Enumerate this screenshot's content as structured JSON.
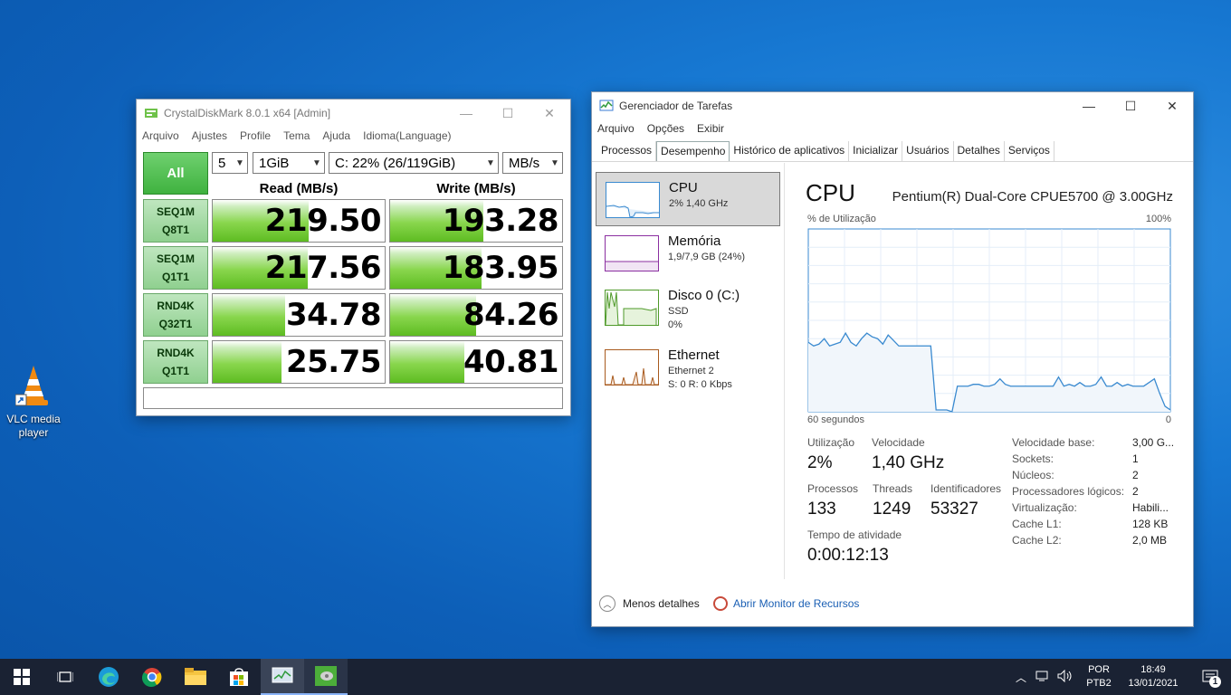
{
  "desktop": {
    "vlc_label": "VLC media player"
  },
  "cdm": {
    "title": "CrystalDiskMark 8.0.1 x64 [Admin]",
    "menu": [
      "Arquivo",
      "Ajustes",
      "Profile",
      "Tema",
      "Ajuda",
      "Idioma(Language)"
    ],
    "all_label": "All",
    "count": "5",
    "size": "1GiB",
    "drive": "C: 22% (26/119GiB)",
    "unit": "MB/s",
    "read_header": "Read (MB/s)",
    "write_header": "Write (MB/s)",
    "rows": [
      {
        "l1": "SEQ1M",
        "l2": "Q8T1",
        "read": "219.50",
        "write": "193.28",
        "read_frac": 0.56,
        "write_frac": 0.54
      },
      {
        "l1": "SEQ1M",
        "l2": "Q1T1",
        "read": "217.56",
        "write": "183.95",
        "read_frac": 0.55,
        "write_frac": 0.53
      },
      {
        "l1": "RND4K",
        "l2": "Q32T1",
        "read": "34.78",
        "write": "84.26",
        "read_frac": 0.42,
        "write_frac": 0.5
      },
      {
        "l1": "RND4K",
        "l2": "Q1T1",
        "read": "25.75",
        "write": "40.81",
        "read_frac": 0.4,
        "write_frac": 0.43
      }
    ]
  },
  "tm": {
    "title": "Gerenciador de Tarefas",
    "menu": [
      "Arquivo",
      "Opções",
      "Exibir"
    ],
    "tabs": [
      "Processos",
      "Desempenho",
      "Histórico de aplicativos",
      "Inicializar",
      "Usuários",
      "Detalhes",
      "Serviços"
    ],
    "side": [
      {
        "title": "CPU",
        "sub1": "2% 1,40 GHz",
        "sub2": "",
        "sub3": ""
      },
      {
        "title": "Memória",
        "sub1": "1,9/7,9 GB (24%)",
        "sub2": "",
        "sub3": ""
      },
      {
        "title": "Disco 0 (C:)",
        "sub1": "SSD",
        "sub2": "0%",
        "sub3": ""
      },
      {
        "title": "Ethernet",
        "sub1": "Ethernet 2",
        "sub2": "S: 0 R: 0 Kbps",
        "sub3": ""
      }
    ],
    "header": "CPU",
    "cpu_name": "Pentium(R) Dual-Core CPUE5700 @ 3.00GHz",
    "util_label": "% de Utilização",
    "pct100": "100%",
    "x_left": "60 segundos",
    "x_right": "0",
    "utilizacao_label": "Utilização",
    "utilizacao": "2%",
    "velocidade_label": "Velocidade",
    "velocidade": "1,40 GHz",
    "processos_label": "Processos",
    "processos": "133",
    "threads_label": "Threads",
    "threads": "1249",
    "ident_label": "Identificadores",
    "ident": "53327",
    "tempo_label": "Tempo de atividade",
    "tempo": "0:00:12:13",
    "specs": [
      {
        "k": "Velocidade base:",
        "v": "3,00 G..."
      },
      {
        "k": "Sockets:",
        "v": "1"
      },
      {
        "k": "Núcleos:",
        "v": "2"
      },
      {
        "k": "Processadores lógicos:",
        "v": "2"
      },
      {
        "k": "Virtualização:",
        "v": "Habili..."
      },
      {
        "k": "Cache L1:",
        "v": "128 KB"
      },
      {
        "k": "Cache L2:",
        "v": "2,0 MB"
      }
    ],
    "less": "Menos detalhes",
    "monitor": "Abrir Monitor de Recursos",
    "cpu_history": [
      38,
      36,
      37,
      40,
      36,
      37,
      38,
      43,
      38,
      36,
      40,
      43,
      41,
      40,
      37,
      42,
      39,
      36,
      36,
      36,
      36,
      36,
      36,
      36,
      1,
      1,
      1,
      0,
      14,
      14,
      14,
      15,
      15,
      14,
      14,
      15,
      18,
      15,
      14,
      14,
      14,
      14,
      14,
      14,
      14,
      14,
      14,
      19,
      14,
      15,
      14,
      16,
      14,
      14,
      15,
      19,
      14,
      14,
      16,
      14,
      15,
      14,
      14,
      14,
      16,
      18,
      10,
      3,
      1
    ]
  },
  "taskbar": {
    "lang1": "POR",
    "lang2": "PTB2",
    "time": "18:49",
    "date": "13/01/2021",
    "notif": "1"
  }
}
